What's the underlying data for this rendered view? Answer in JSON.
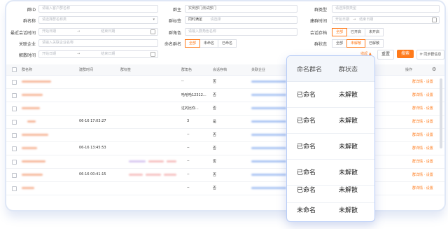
{
  "filters": {
    "group_id": {
      "label": "群ID",
      "placeholder": "请输入客户群名称"
    },
    "group_name": {
      "label": "群名称",
      "placeholder": "请选择群名称类"
    },
    "recent_talk_time": {
      "label": "最近会话时间",
      "start": "开始日期",
      "end": "结束日期"
    },
    "related_company": {
      "label": "关联企业",
      "placeholder": "请输入关联企业名称"
    },
    "dissolve_time": {
      "label": "解散时间",
      "start": "开始日期",
      "end": "结束日期"
    },
    "group_owner": {
      "label": "群主",
      "value": "实例部门测试部门"
    },
    "group_tag": {
      "label": "群标签",
      "mode": "同时满足",
      "placeholder": "请选择"
    },
    "group_role": {
      "label": "群角色",
      "placeholder": "请输入群角色名称"
    },
    "named_group": {
      "label": "命名群名",
      "options": [
        "全部",
        "未命名",
        "已命名"
      ],
      "active": 0
    },
    "group_type": {
      "label": "群类型",
      "placeholder": "请选择群类型"
    },
    "create_time": {
      "label": "建群时间",
      "start": "开始日期",
      "end": "结束日期"
    },
    "session_archive": {
      "label": "会话存档",
      "options": [
        "全部",
        "已开启",
        "未开启"
      ],
      "active": 0
    },
    "group_status": {
      "label": "群状态",
      "options": [
        "全部",
        "未解散",
        "已解散"
      ],
      "active": 1
    }
  },
  "actions": {
    "collapse": "收起 ▲",
    "reset": "重置",
    "search": "搜索",
    "sync": "同步群信息"
  },
  "table": {
    "headers": [
      "群名称",
      "建群时间",
      "群标签",
      "群角色",
      "会话存档",
      "关联企业",
      "操作"
    ],
    "rows": [
      {
        "time": "",
        "role": "--",
        "archive": "否"
      },
      {
        "time": "",
        "role": "哈哈哈12312...",
        "archive": "否"
      },
      {
        "time": "",
        "role": "过的比你...",
        "archive": "否"
      },
      {
        "time": "06-16 17:03:27",
        "role": "3",
        "archive": "是"
      },
      {
        "time": "",
        "role": "--",
        "archive": "否"
      },
      {
        "time": "06-16 13:45:53",
        "role": "--",
        "archive": "否"
      },
      {
        "time": "",
        "role": "--",
        "archive": "否"
      },
      {
        "time": "06-16 00:41:15",
        "role": "--",
        "archive": "否"
      },
      {
        "time": "",
        "role": "--",
        "archive": "否"
      }
    ],
    "op_label": "群详情 · 设置"
  },
  "popup": {
    "headers": [
      "命名群名",
      "群状态"
    ],
    "rows": [
      [
        "已命名",
        "未解散"
      ],
      [
        "已命名",
        "未解散"
      ],
      [
        "已命名",
        "未解散"
      ],
      [
        "已命名",
        "未解散"
      ],
      [
        "已命名",
        "未解散"
      ],
      [
        "未命名",
        "未解散"
      ]
    ]
  },
  "colors": {
    "accent": "#ff7a1a",
    "popup_border": "#b8cdf7",
    "link_blur": "#a9c3f3",
    "name_blur": "#f6b79a"
  }
}
